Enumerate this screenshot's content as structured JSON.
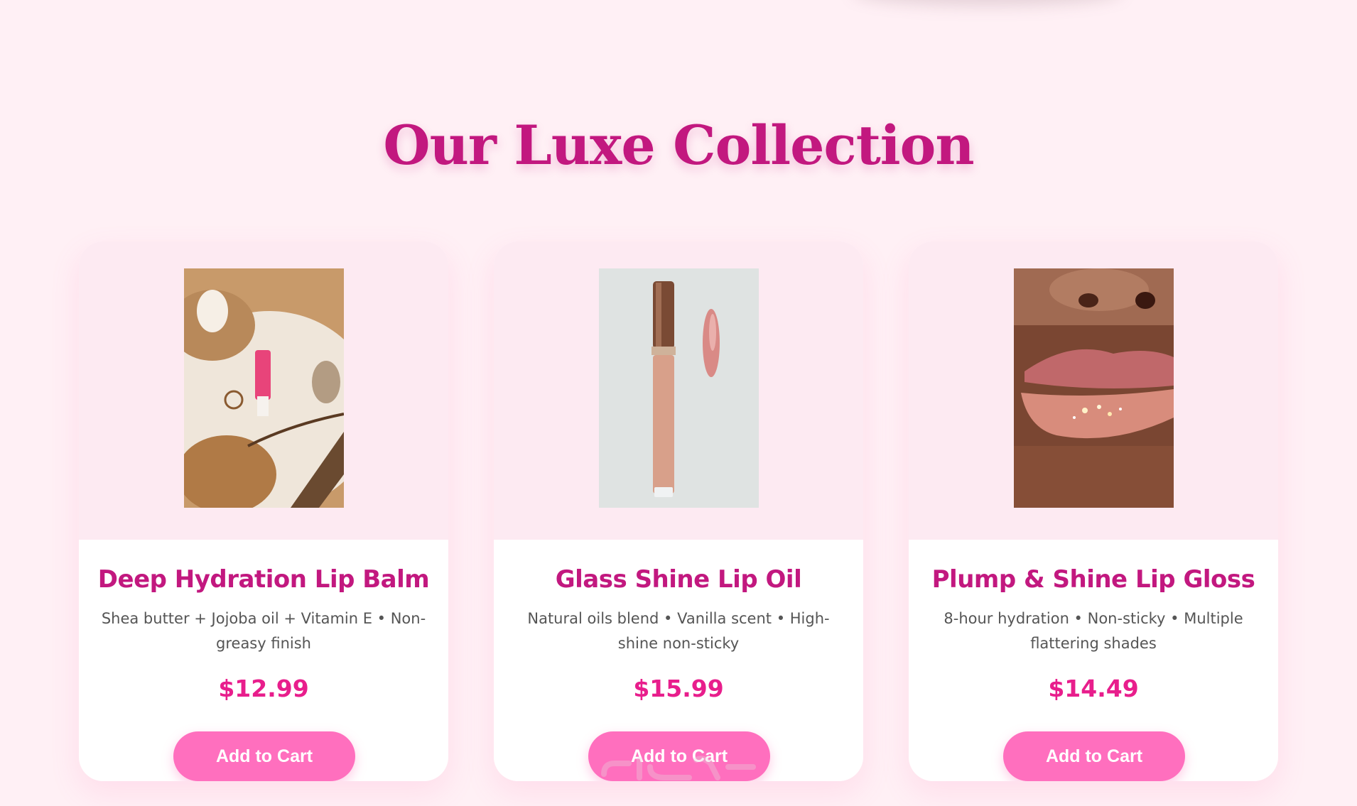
{
  "section": {
    "title": "Our Luxe Collection"
  },
  "products": [
    {
      "name": "Deep Hydration Lip Balm",
      "description": "Shea butter + Jojoba oil + Vitamin E • Non-greasy finish",
      "price": "$12.99",
      "button_label": "Add to Cart"
    },
    {
      "name": "Glass Shine Lip Oil",
      "description": "Natural oils blend • Vanilla scent • High-shine non-sticky",
      "price": "$15.99",
      "button_label": "Add to Cart"
    },
    {
      "name": "Plump & Shine Lip Gloss",
      "description": "8-hour hydration • Non-sticky • Multiple flattering shades",
      "price": "$14.49",
      "button_label": "Add to Cart"
    }
  ],
  "colors": {
    "page_background": "#fff0f5",
    "title": "#c2187f",
    "price": "#e81e8c",
    "button": "#ff6fbe"
  }
}
